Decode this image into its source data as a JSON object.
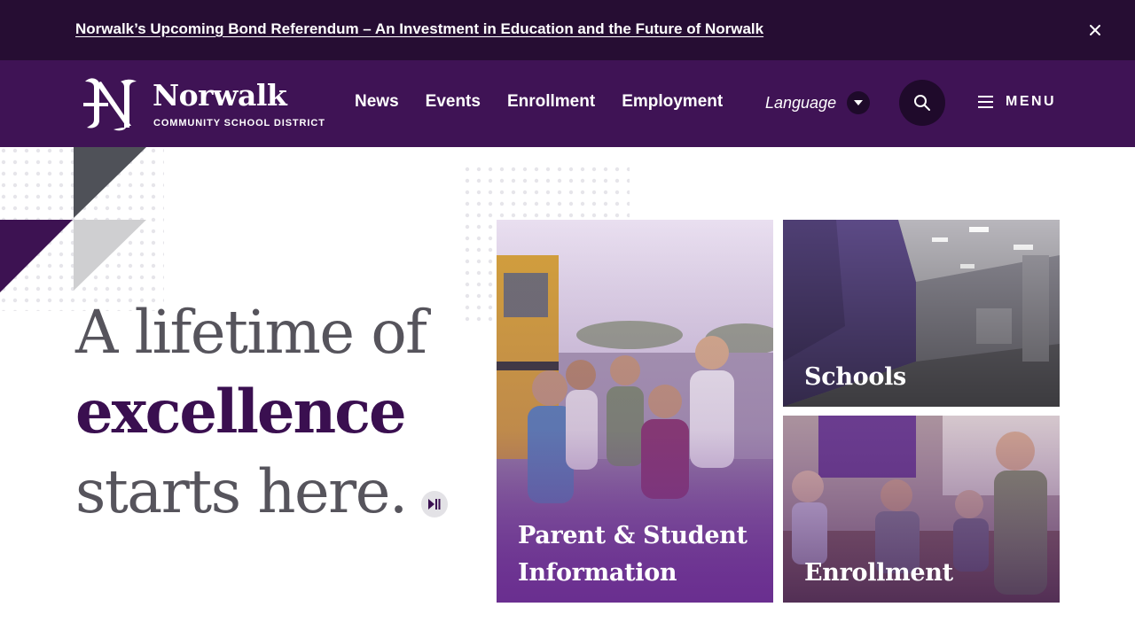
{
  "alert": {
    "link_text": "Norwalk’s Upcoming Bond Referendum – An Investment in Education and the Future of Norwalk",
    "close_icon": "close-icon"
  },
  "header": {
    "logo": {
      "name": "Norwalk",
      "subtitle": "COMMUNITY SCHOOL DISTRICT",
      "mark_letter": "N"
    },
    "nav": [
      {
        "label": "News"
      },
      {
        "label": "Events"
      },
      {
        "label": "Enrollment"
      },
      {
        "label": "Employment"
      }
    ],
    "language": {
      "label": "Language",
      "icon": "caret-down-icon"
    },
    "search": {
      "icon": "search-icon"
    },
    "menu": {
      "label": "MENU",
      "icon": "hamburger-icon"
    }
  },
  "hero": {
    "line1": "A lifetime of",
    "line2": "excellence",
    "line3": "starts here.",
    "play_pause_icon": "play-pause-icon"
  },
  "tiles": [
    {
      "label_line1": "Parent & Student",
      "label_line2": "Information"
    },
    {
      "label": "Schools"
    },
    {
      "label": "Enrollment"
    }
  ],
  "colors": {
    "alert_bg": "#260d33",
    "header_bg": "#3f1355",
    "accent_purple": "#3a0f50",
    "headline_gray": "#56545c",
    "tile_overlay": "#6a2f8f"
  }
}
